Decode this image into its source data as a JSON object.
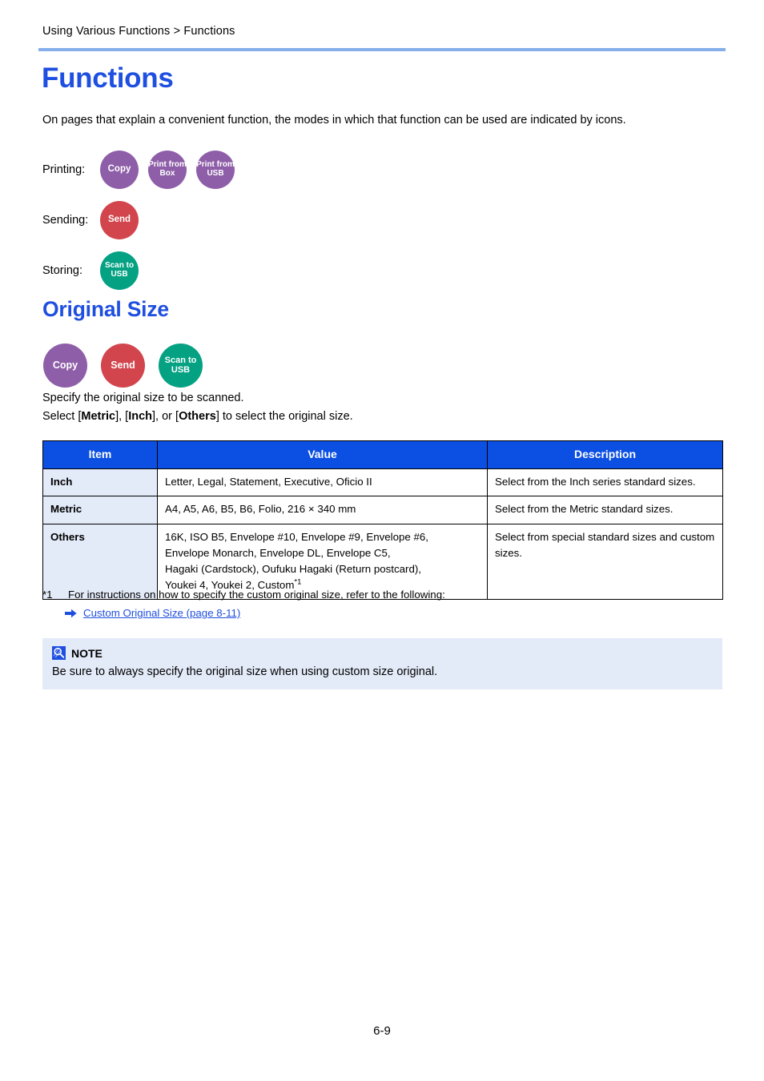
{
  "breadcrumb": "Using Various Functions > Functions",
  "page_title": "Functions",
  "intro": "On pages that explain a convenient function, the modes in which that function can be used are indicated by icons.",
  "modes": [
    {
      "label": "Printing:",
      "badges": [
        {
          "name": "copy-badge",
          "text": "Copy",
          "color": "#8E5EA8",
          "lines": [
            "Copy"
          ]
        },
        {
          "name": "print-from-box-badge",
          "text": "Print from Box",
          "color": "#8E5EA8",
          "lines": [
            "Print from",
            "Box"
          ]
        },
        {
          "name": "print-from-usb-badge",
          "text": "Print from USB",
          "color": "#8E5EA8",
          "lines": [
            "Print from",
            "USB"
          ]
        }
      ]
    },
    {
      "label": "Sending:",
      "badges": [
        {
          "name": "send-badge",
          "text": "Send",
          "color": "#D2454D",
          "lines": [
            "Send"
          ]
        }
      ]
    },
    {
      "label": "Storing:",
      "badges": [
        {
          "name": "scan-to-usb-badge",
          "text": "Scan to USB",
          "color": "#04A183",
          "lines": [
            "Scan to",
            "USB"
          ]
        }
      ]
    }
  ],
  "section": {
    "title": "Original Size",
    "badges": [
      {
        "name": "copy-badge",
        "color": "#8E5EA8",
        "lines": [
          "Copy"
        ]
      },
      {
        "name": "send-badge",
        "color": "#D2454D",
        "lines": [
          "Send"
        ]
      },
      {
        "name": "scan-to-usb-badge",
        "color": "#04A183",
        "lines": [
          "Scan to",
          "USB"
        ]
      }
    ],
    "desc_line1": "Specify the original size to be scanned.",
    "desc_line2_pre": "Select [",
    "desc_line2_b1": "Metric",
    "desc_line2_mid1": "], [",
    "desc_line2_b2": "Inch",
    "desc_line2_mid2": "], or [",
    "desc_line2_b3": "Others",
    "desc_line2_post": "] to select the original size."
  },
  "table": {
    "headers": [
      "Item",
      "Value",
      "Description"
    ],
    "rows": [
      {
        "item": "Inch",
        "value_lines": [
          "Letter, Legal, Statement, Executive, Oficio II"
        ],
        "value_sup": "",
        "description": "Select from the Inch series standard sizes."
      },
      {
        "item": "Metric",
        "value_lines": [
          "A4, A5, A6, B5, B6, Folio, 216 × 340 mm"
        ],
        "value_sup": "",
        "description": "Select from the Metric standard sizes."
      },
      {
        "item": "Others",
        "value_lines": [
          "16K, ISO B5, Envelope #10, Envelope #9, Envelope #6,",
          "Envelope Monarch, Envelope DL, Envelope C5,",
          "Hagaki (Cardstock), Oufuku Hagaki (Return postcard),",
          "Youkei 4, Youkei 2, Custom"
        ],
        "value_sup": "*1",
        "description": "Select from special standard sizes and custom sizes."
      }
    ]
  },
  "footnote": {
    "mark": "*1",
    "text": "For instructions on how to specify the custom original size, refer to the following:",
    "link": "Custom Original Size (page 8-11)"
  },
  "note": {
    "title": "NOTE",
    "body": "Be sure to always specify the original size when using custom size original."
  },
  "footer": {
    "page_number": "6-9"
  },
  "colors": {
    "heading_blue": "#1F4FE0",
    "rule_blue": "#85AEEB",
    "table_header_blue": "#0B4FE3",
    "tint_lavender": "#E3EAF8",
    "purple": "#8E5EA8",
    "red": "#D2454D",
    "teal": "#04A183"
  }
}
